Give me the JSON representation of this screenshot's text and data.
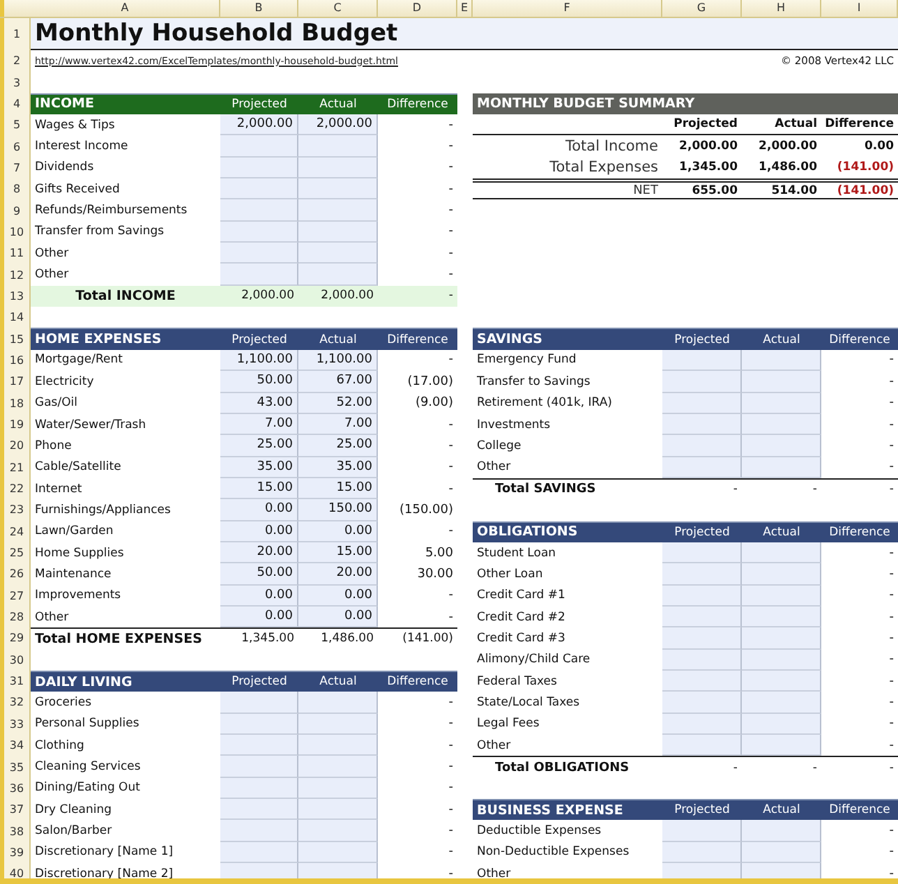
{
  "columns": [
    "A",
    "B",
    "C",
    "D",
    "E",
    "F",
    "G",
    "H",
    "I"
  ],
  "row_numbers": [
    "1",
    "2",
    "3",
    "4",
    "5",
    "6",
    "7",
    "8",
    "9",
    "10",
    "11",
    "12",
    "13",
    "14",
    "15",
    "16",
    "17",
    "18",
    "19",
    "20",
    "21",
    "22",
    "23",
    "24",
    "25",
    "26",
    "27",
    "28",
    "29",
    "30",
    "31",
    "32",
    "33",
    "34",
    "35",
    "36",
    "37",
    "38",
    "39",
    "40"
  ],
  "title": "Monthly Household Budget",
  "url": "http://www.vertex42.com/ExcelTemplates/monthly-household-budget.html",
  "copyright": "© 2008 Vertex42 LLC",
  "left_sections": [
    {
      "title": "INCOME",
      "color": "#1e6b1e",
      "headers": [
        "Projected",
        "Actual",
        "Difference"
      ],
      "items": [
        {
          "label": "Wages & Tips",
          "projected": "2,000.00",
          "actual": "2,000.00",
          "difference": "-"
        },
        {
          "label": "Interest Income",
          "difference": "-"
        },
        {
          "label": "Dividends",
          "difference": "-"
        },
        {
          "label": "Gifts Received",
          "difference": "-"
        },
        {
          "label": "Refunds/Reimbursements",
          "difference": "-"
        },
        {
          "label": "Transfer from Savings",
          "difference": "-"
        },
        {
          "label": "Other",
          "difference": "-"
        },
        {
          "label": "Other",
          "difference": "-"
        }
      ],
      "total": {
        "kind": "highlight",
        "label": "Total INCOME",
        "projected": "2,000.00",
        "actual": "2,000.00",
        "difference": "-"
      }
    },
    {
      "title": "HOME EXPENSES",
      "color": "#34497a",
      "headers": [
        "Projected",
        "Actual",
        "Difference"
      ],
      "items": [
        {
          "label": "Mortgage/Rent",
          "projected": "1,100.00",
          "actual": "1,100.00",
          "difference": "-"
        },
        {
          "label": "Electricity",
          "projected": "50.00",
          "actual": "67.00",
          "difference": "(17.00)"
        },
        {
          "label": "Gas/Oil",
          "projected": "43.00",
          "actual": "52.00",
          "difference": "(9.00)"
        },
        {
          "label": "Water/Sewer/Trash",
          "projected": "7.00",
          "actual": "7.00",
          "difference": "-"
        },
        {
          "label": "Phone",
          "projected": "25.00",
          "actual": "25.00",
          "difference": "-"
        },
        {
          "label": "Cable/Satellite",
          "projected": "35.00",
          "actual": "35.00",
          "difference": "-"
        },
        {
          "label": "Internet",
          "projected": "15.00",
          "actual": "15.00",
          "difference": "-"
        },
        {
          "label": "Furnishings/Appliances",
          "projected": "0.00",
          "actual": "150.00",
          "difference": "(150.00)"
        },
        {
          "label": "Lawn/Garden",
          "projected": "0.00",
          "actual": "0.00",
          "difference": "-"
        },
        {
          "label": "Home Supplies",
          "projected": "20.00",
          "actual": "15.00",
          "difference": "5.00"
        },
        {
          "label": "Maintenance",
          "projected": "50.00",
          "actual": "20.00",
          "difference": "30.00"
        },
        {
          "label": "Improvements",
          "projected": "0.00",
          "actual": "0.00",
          "difference": "-"
        },
        {
          "label": "Other",
          "projected": "0.00",
          "actual": "0.00",
          "difference": "-"
        }
      ],
      "total": {
        "kind": "ruled",
        "label": "Total HOME EXPENSES",
        "projected": "1,345.00",
        "actual": "1,486.00",
        "difference": "(141.00)"
      }
    },
    {
      "title": "DAILY LIVING",
      "color": "#34497a",
      "headers": [
        "Projected",
        "Actual",
        "Difference"
      ],
      "items": [
        {
          "label": "Groceries",
          "difference": "-"
        },
        {
          "label": "Personal Supplies",
          "difference": "-"
        },
        {
          "label": "Clothing",
          "difference": "-"
        },
        {
          "label": "Cleaning Services",
          "difference": "-"
        },
        {
          "label": "Dining/Eating Out",
          "difference": "-"
        },
        {
          "label": "Dry Cleaning",
          "difference": "-"
        },
        {
          "label": "Salon/Barber",
          "difference": "-"
        },
        {
          "label": "Discretionary [Name 1]",
          "difference": "-"
        },
        {
          "label": "Discretionary [Name 2]",
          "difference": "-"
        }
      ]
    }
  ],
  "summary": {
    "title": "MONTHLY BUDGET SUMMARY",
    "headers": [
      "Projected",
      "Actual",
      "Difference"
    ],
    "rows": [
      {
        "kind": "line",
        "label": "Total Income",
        "projected": "2,000.00",
        "actual": "2,000.00",
        "difference": "0.00",
        "negative": false
      },
      {
        "kind": "line",
        "label": "Total Expenses",
        "projected": "1,345.00",
        "actual": "1,486.00",
        "difference": "(141.00)",
        "negative": true
      },
      {
        "kind": "net",
        "label": "NET",
        "projected": "655.00",
        "actual": "514.00",
        "difference": "(141.00)",
        "negative": true
      }
    ]
  },
  "right_sections": [
    {
      "title": "SAVINGS",
      "color": "#34497a",
      "headers": [
        "Projected",
        "Actual",
        "Difference"
      ],
      "items": [
        {
          "label": "Emergency Fund",
          "difference": "-"
        },
        {
          "label": "Transfer to Savings",
          "difference": "-"
        },
        {
          "label": "Retirement (401k, IRA)",
          "difference": "-"
        },
        {
          "label": "Investments",
          "difference": "-"
        },
        {
          "label": "College",
          "difference": "-"
        },
        {
          "label": "Other",
          "difference": "-"
        }
      ],
      "total": {
        "kind": "ruled",
        "label": "Total SAVINGS",
        "projected": "-",
        "actual": "-",
        "difference": "-"
      }
    },
    {
      "title": "OBLIGATIONS",
      "color": "#34497a",
      "headers": [
        "Projected",
        "Actual",
        "Difference"
      ],
      "items": [
        {
          "label": "Student Loan",
          "difference": "-"
        },
        {
          "label": "Other Loan",
          "difference": "-"
        },
        {
          "label": "Credit Card #1",
          "difference": "-"
        },
        {
          "label": "Credit Card #2",
          "difference": "-"
        },
        {
          "label": "Credit Card #3",
          "difference": "-"
        },
        {
          "label": "Alimony/Child Care",
          "difference": "-"
        },
        {
          "label": "Federal Taxes",
          "difference": "-"
        },
        {
          "label": "State/Local Taxes",
          "difference": "-"
        },
        {
          "label": "Legal Fees",
          "difference": "-"
        },
        {
          "label": "Other",
          "difference": "-"
        }
      ],
      "total": {
        "kind": "ruled",
        "label": "Total OBLIGATIONS",
        "projected": "-",
        "actual": "-",
        "difference": "-"
      }
    },
    {
      "title": "BUSINESS EXPENSE",
      "color": "#34497a",
      "headers": [
        "Projected",
        "Actual",
        "Difference"
      ],
      "items": [
        {
          "label": "Deductible Expenses",
          "difference": "-"
        },
        {
          "label": "Non-Deductible Expenses",
          "difference": "-"
        },
        {
          "label": "Other",
          "difference": "-"
        }
      ]
    }
  ]
}
